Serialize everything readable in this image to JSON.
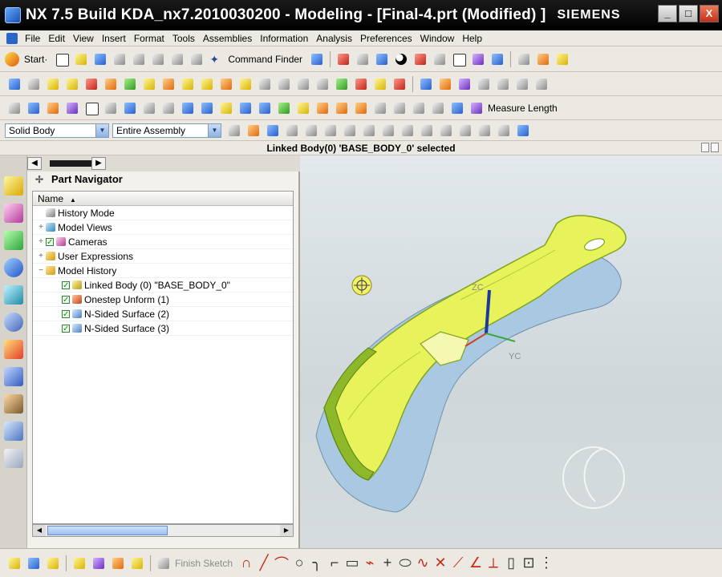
{
  "window": {
    "title": "NX 7.5  Build KDA_nx7.2010030200 - Modeling - [Final-4.prt (Modified) ]",
    "brand": "SIEMENS",
    "minimize": "_",
    "maximize": "□",
    "close": "X"
  },
  "menu": {
    "items": [
      "File",
      "Edit",
      "View",
      "Insert",
      "Format",
      "Tools",
      "Assemblies",
      "Information",
      "Analysis",
      "Preferences",
      "Window",
      "Help"
    ]
  },
  "toolbar": {
    "start_label": "Start·",
    "command_finder_label": "Command Finder",
    "measure_length_label": "Measure Length"
  },
  "selection_bar": {
    "type_filter": "Solid Body",
    "scope": "Entire Assembly"
  },
  "status": {
    "message": "Linked Body(0) 'BASE_BODY_0' selected"
  },
  "navigator": {
    "title": "Part Navigator",
    "column_name": "Name",
    "sort_indicator": "▲",
    "rows": [
      {
        "label": "History Mode",
        "expand": "",
        "checked": false,
        "icon": "history-icon"
      },
      {
        "label": "Model Views",
        "expand": "+",
        "checked": false,
        "icon": "model-views-icon"
      },
      {
        "label": "Cameras",
        "expand": "+",
        "checked": true,
        "icon": "camera-icon"
      },
      {
        "label": "User Expressions",
        "expand": "+",
        "checked": false,
        "icon": "folder-icon"
      },
      {
        "label": "Model History",
        "expand": "−",
        "checked": false,
        "icon": "folder-icon"
      },
      {
        "label": "Linked Body (0) \"BASE_BODY_0\"",
        "expand": "",
        "checked": true,
        "icon": "linked-body-icon"
      },
      {
        "label": "Onestep Unform (1)",
        "expand": "",
        "checked": true,
        "icon": "unform-icon"
      },
      {
        "label": "N-Sided Surface (2)",
        "expand": "",
        "checked": true,
        "icon": "surface-icon"
      },
      {
        "label": "N-Sided Surface (3)",
        "expand": "",
        "checked": true,
        "icon": "surface-icon"
      }
    ]
  },
  "viewport": {
    "axis_z": "ZC",
    "axis_y": "YC",
    "part_color": "#e8f25a",
    "part_edge_color": "#7fa51c",
    "shadow_color": "#9fc3df"
  },
  "bottom_toolbar": {
    "finish_sketch_label": "Finish Sketch"
  },
  "colors": {
    "title_bar": "#000000",
    "accent_red": "#c52b1b"
  }
}
